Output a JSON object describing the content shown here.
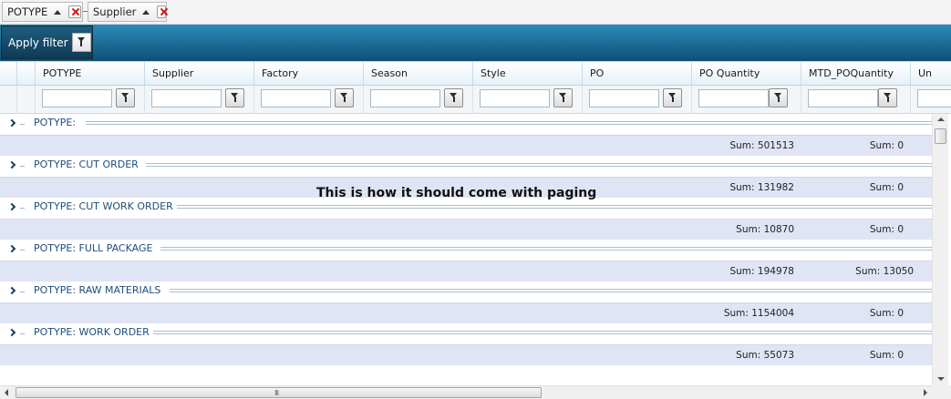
{
  "group_panel": {
    "chips": [
      {
        "label": "POTYPE"
      },
      {
        "label": "Supplier"
      }
    ]
  },
  "toolbar": {
    "apply_filter_label": "Apply filter"
  },
  "grid": {
    "columns": [
      "POTYPE",
      "Supplier",
      "Factory",
      "Season",
      "Style",
      "PO",
      "PO Quantity",
      "MTD_POQuantity",
      "Un"
    ],
    "filter_values": [
      "",
      "",
      "",
      "",
      "",
      "",
      "",
      ""
    ],
    "groups": [
      {
        "label": "POTYPE:",
        "sum_po_quantity": "Sum: 501513",
        "sum_mtd": "Sum: 0"
      },
      {
        "label": "POTYPE: CUT ORDER",
        "sum_po_quantity": "Sum: 131982",
        "sum_mtd": "Sum: 0"
      },
      {
        "label": "POTYPE: CUT WORK ORDER",
        "sum_po_quantity": "Sum: 10870",
        "sum_mtd": "Sum: 0"
      },
      {
        "label": "POTYPE: FULL PACKAGE",
        "sum_po_quantity": "Sum: 194978",
        "sum_mtd": "Sum: 13050"
      },
      {
        "label": "POTYPE: RAW MATERIALS",
        "sum_po_quantity": "Sum: 1154004",
        "sum_mtd": "Sum: 0"
      },
      {
        "label": "POTYPE: WORK ORDER",
        "sum_po_quantity": "Sum: 55073",
        "sum_mtd": "Sum: 0"
      }
    ]
  },
  "overlay_note": "This is how it should come with paging",
  "scrollbar": {
    "grip": "III"
  },
  "icons": {
    "group_sort": "sort-ascending-icon",
    "group_remove": "remove-group-icon",
    "filter": "funnel-icon",
    "expand": "chevron-right-icon"
  },
  "colors": {
    "toolbar": "#1c6e99",
    "group_text": "#1d4e7a",
    "footer_row": "#dfe5f4",
    "remove_x": "#d21414"
  }
}
